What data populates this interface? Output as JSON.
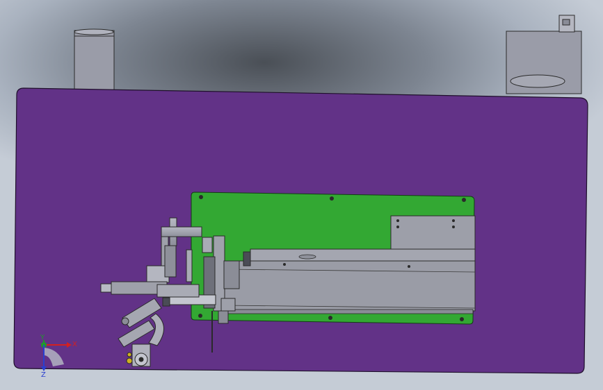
{
  "viewport": {
    "background_top": "#6f7782",
    "background_bottom": "#c5ccd6"
  },
  "model": {
    "base_plate_color": "#623287",
    "mount_plate_color": "#33a833",
    "metal_color": "#9a9ca6",
    "dark_metal_color": "#5a5c66"
  },
  "triad": {
    "x_label": "X",
    "y_label": "Y",
    "z_label": "Z",
    "x_color": "#d42020",
    "y_color": "#1f9a2a",
    "z_color": "#2a3fd0"
  }
}
